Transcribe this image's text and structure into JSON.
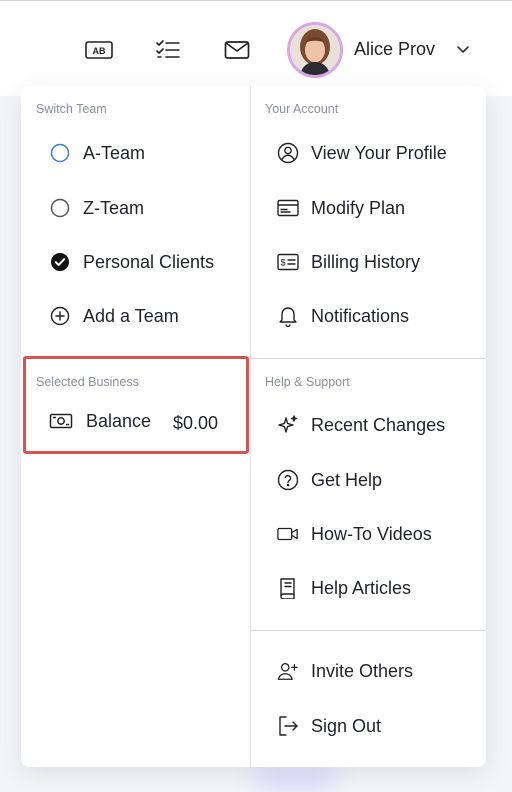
{
  "header": {
    "user_name": "Alice Prov",
    "icons": [
      "ab-icon",
      "checklist-icon",
      "mail-icon",
      "avatar",
      "chevron-down-icon"
    ]
  },
  "switch_team": {
    "title": "Switch Team",
    "items": [
      {
        "label": "A-Team",
        "icon": "radio-unselected-blue-icon"
      },
      {
        "label": "Z-Team",
        "icon": "radio-unselected-icon"
      },
      {
        "label": "Personal Clients",
        "icon": "check-circle-filled-icon"
      },
      {
        "label": "Add a Team",
        "icon": "plus-circle-icon"
      }
    ]
  },
  "selected_business": {
    "title": "Selected Business",
    "balance_label": "Balance",
    "balance_amount": "$0.00",
    "icon": "cash-icon",
    "highlight_color": "#d9534f"
  },
  "account": {
    "title": "Your Account",
    "items": [
      {
        "label": "View Your Profile",
        "icon": "user-circle-icon"
      },
      {
        "label": "Modify Plan",
        "icon": "card-icon"
      },
      {
        "label": "Billing History",
        "icon": "receipt-dollar-icon"
      },
      {
        "label": "Notifications",
        "icon": "bell-icon"
      }
    ]
  },
  "help": {
    "title": "Help & Support",
    "items": [
      {
        "label": "Recent Changes",
        "icon": "sparkle-icon"
      },
      {
        "label": "Get Help",
        "icon": "question-circle-icon"
      },
      {
        "label": "How-To Videos",
        "icon": "video-camera-icon"
      },
      {
        "label": "Help Articles",
        "icon": "book-icon"
      }
    ]
  },
  "footer_items": [
    {
      "label": "Invite Others",
      "icon": "user-plus-icon"
    },
    {
      "label": "Sign Out",
      "icon": "sign-out-icon"
    }
  ],
  "colors": {
    "accent_blue": "#3d7bd9",
    "text": "#1f2328",
    "muted": "#8a8f98",
    "avatar_ring": "#d9a6e6"
  }
}
